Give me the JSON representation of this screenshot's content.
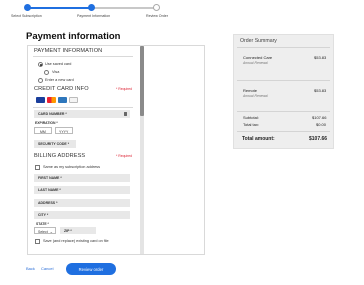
{
  "stepper": {
    "steps": [
      {
        "label": "Select Subscription",
        "state": "done"
      },
      {
        "label": "Payment Information",
        "state": "current"
      },
      {
        "label": "Review Order",
        "state": "pending"
      }
    ],
    "accent": "#1f6fe0"
  },
  "page": {
    "title": "Payment information"
  },
  "payment": {
    "section_title": "PAYMENT INFORMATION",
    "options": [
      "Use saved card",
      "Visa",
      "Enter a new card"
    ],
    "selected": "Use saved card"
  },
  "card": {
    "section_title": "CREDIT CARD INFO",
    "required": "* Required",
    "number_label": "CARD NUMBER *",
    "expiration_label": "EXPIRATION *",
    "month_placeholder": "MM",
    "year_placeholder": "YYYY",
    "security_label": "SECURITY CODE *",
    "logos": [
      "visa",
      "mastercard",
      "amex",
      "discover"
    ]
  },
  "billing": {
    "section_title": "BILLING ADDRESS",
    "required": "* Required",
    "same_as_label": "Same as my subscription address",
    "first_name": "FIRST NAME *",
    "last_name": "LAST NAME *",
    "address": "ADDRESS *",
    "city": "CITY *",
    "state_label": "STATE *",
    "state_value": "Select",
    "zip_label": "ZIP *",
    "save_label": "Save (and replace) existing card on file"
  },
  "summary": {
    "title": "Order Summary",
    "items": [
      {
        "name": "Connected Care",
        "sub": "Annual Renewal",
        "price": "$53.83"
      },
      {
        "name": "Remote",
        "sub": "Annual Renewal",
        "price": "$53.83"
      }
    ],
    "subtotal_label": "Subtotal:",
    "subtotal_value": "$107.66",
    "tax_label": "Total tax:",
    "tax_value": "$0.00",
    "total_label": "Total amount:",
    "total_value": "$107.66"
  },
  "footer": {
    "back": "Back",
    "cancel": "Cancel",
    "review": "Review order"
  }
}
